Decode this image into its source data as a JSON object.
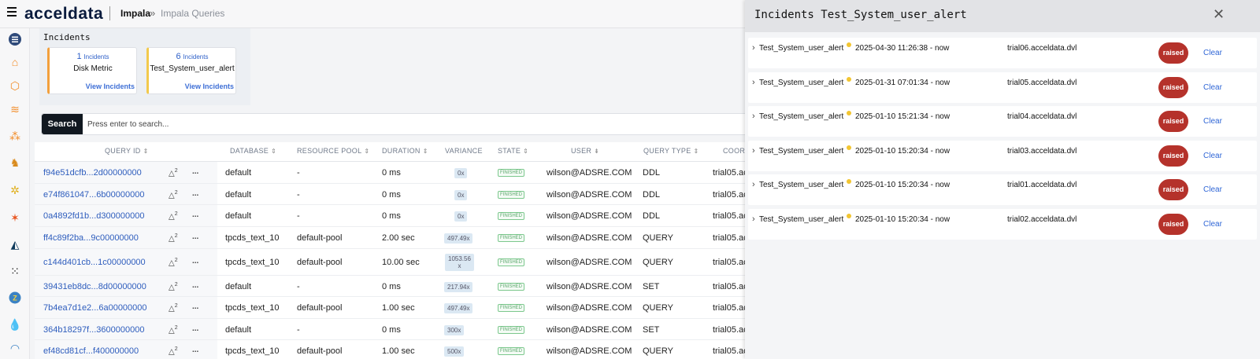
{
  "header": {
    "logo": "acceldata",
    "breadcrumb_main": "Impala",
    "breadcrumb_sep": "»",
    "breadcrumb_sub": "Impala Queries"
  },
  "sidebar": {
    "icons": [
      "list-icon",
      "home-icon",
      "cube-icon",
      "layers-icon",
      "hierarchy-icon",
      "elephant-icon",
      "bee-icon",
      "spark-icon",
      "dolphin-icon",
      "nodes-icon",
      "zookeeper-icon",
      "drop-icon",
      "scroll-icon"
    ]
  },
  "incidents": {
    "title": "Incidents",
    "cards": [
      {
        "count": "1",
        "count_label": "Incidents",
        "name": "Disk Metric",
        "link": "View Incidents",
        "color": "#f2a03d"
      },
      {
        "count": "6",
        "count_label": "Incidents",
        "name": "Test_System_user_alert",
        "link": "View Incidents",
        "color": "#f2c94c"
      }
    ]
  },
  "search": {
    "button": "Search",
    "placeholder": "Press enter to search..."
  },
  "table": {
    "headers": {
      "query_id": "QUERY ID",
      "database": "DATABASE",
      "resource_pool": "RESOURCE POOL",
      "duration": "DURATION",
      "variance": "VARIANCE",
      "state": "STATE",
      "user": "USER",
      "query_type": "QUERY TYPE",
      "coord": "COORD"
    },
    "rows": [
      {
        "id": "f94e51dcfb...2d00000000",
        "alerts": "2",
        "more": "...",
        "db": "default",
        "pool": "-",
        "duration": "0 ms",
        "variance": "0x",
        "state": "FINISHED",
        "user": "wilson@ADSRE.COM",
        "type": "DDL",
        "coord": "trial05.ac"
      },
      {
        "id": "e74f861047...6b00000000",
        "alerts": "2",
        "more": "...",
        "db": "default",
        "pool": "-",
        "duration": "0 ms",
        "variance": "0x",
        "state": "FINISHED",
        "user": "wilson@ADSRE.COM",
        "type": "DDL",
        "coord": "trial05.ac"
      },
      {
        "id": "0a4892fd1b...d300000000",
        "alerts": "2",
        "more": "...",
        "db": "default",
        "pool": "-",
        "duration": "0 ms",
        "variance": "0x",
        "state": "FINISHED",
        "user": "wilson@ADSRE.COM",
        "type": "DDL",
        "coord": "trial05.ac"
      },
      {
        "id": "ff4c89f2ba...9c00000000",
        "alerts": "2",
        "more": "...",
        "db": "tpcds_text_10",
        "pool": "default-pool",
        "duration": "2.00 sec",
        "variance": "497.49x",
        "state": "FINISHED",
        "user": "wilson@ADSRE.COM",
        "type": "QUERY",
        "coord": "trial05.ac"
      },
      {
        "id": "c144d401cb...1c00000000",
        "alerts": "2",
        "more": "...",
        "db": "tpcds_text_10",
        "pool": "default-pool",
        "duration": "10.00 sec",
        "variance": "1053.56",
        "variance2": "x",
        "state": "FINISHED",
        "user": "wilson@ADSRE.COM",
        "type": "QUERY",
        "coord": "trial05.ac"
      },
      {
        "id": "39431eb8dc...8d00000000",
        "alerts": "2",
        "more": "...",
        "db": "default",
        "pool": "-",
        "duration": "0 ms",
        "variance": "217.94x",
        "state": "FINISHED",
        "user": "wilson@ADSRE.COM",
        "type": "SET",
        "coord": "trial05.ac"
      },
      {
        "id": "7b4ea7d1e2...6a00000000",
        "alerts": "2",
        "more": "...",
        "db": "tpcds_text_10",
        "pool": "default-pool",
        "duration": "1.00 sec",
        "variance": "497.49x",
        "state": "FINISHED",
        "user": "wilson@ADSRE.COM",
        "type": "QUERY",
        "coord": "trial05.ac"
      },
      {
        "id": "364b18297f...3600000000",
        "alerts": "2",
        "more": "...",
        "db": "default",
        "pool": "-",
        "duration": "0 ms",
        "variance": "300x",
        "state": "FINISHED",
        "user": "wilson@ADSRE.COM",
        "type": "SET",
        "coord": "trial05.ac"
      },
      {
        "id": "ef48cd81cf...f400000000",
        "alerts": "2",
        "more": "...",
        "db": "tpcds_text_10",
        "pool": "default-pool",
        "duration": "1.00 sec",
        "variance": "500x",
        "state": "FINISHED",
        "user": "wilson@ADSRE.COM",
        "type": "QUERY",
        "coord": "trial05.ac"
      }
    ]
  },
  "panel": {
    "title": "Incidents Test_System_user_alert",
    "close": "✕",
    "alerts": [
      {
        "name": "Test_System_user_alert",
        "time": "2025-04-30 11:26:38 - now",
        "host": "trial06.acceldata.dvl",
        "status": "raised",
        "action": "Clear"
      },
      {
        "name": "Test_System_user_alert",
        "time": "2025-01-31 07:01:34 - now",
        "host": "trial05.acceldata.dvl",
        "status": "raised",
        "action": "Clear"
      },
      {
        "name": "Test_System_user_alert",
        "time": "2025-01-10 15:21:34 - now",
        "host": "trial04.acceldata.dvl",
        "status": "raised",
        "action": "Clear"
      },
      {
        "name": "Test_System_user_alert",
        "time": "2025-01-10 15:20:34 - now",
        "host": "trial03.acceldata.dvl",
        "status": "raised",
        "action": "Clear"
      },
      {
        "name": "Test_System_user_alert",
        "time": "2025-01-10 15:20:34 - now",
        "host": "trial01.acceldata.dvl",
        "status": "raised",
        "action": "Clear"
      },
      {
        "name": "Test_System_user_alert",
        "time": "2025-01-10 15:20:34 - now",
        "host": "trial02.acceldata.dvl",
        "status": "raised",
        "action": "Clear"
      }
    ]
  }
}
